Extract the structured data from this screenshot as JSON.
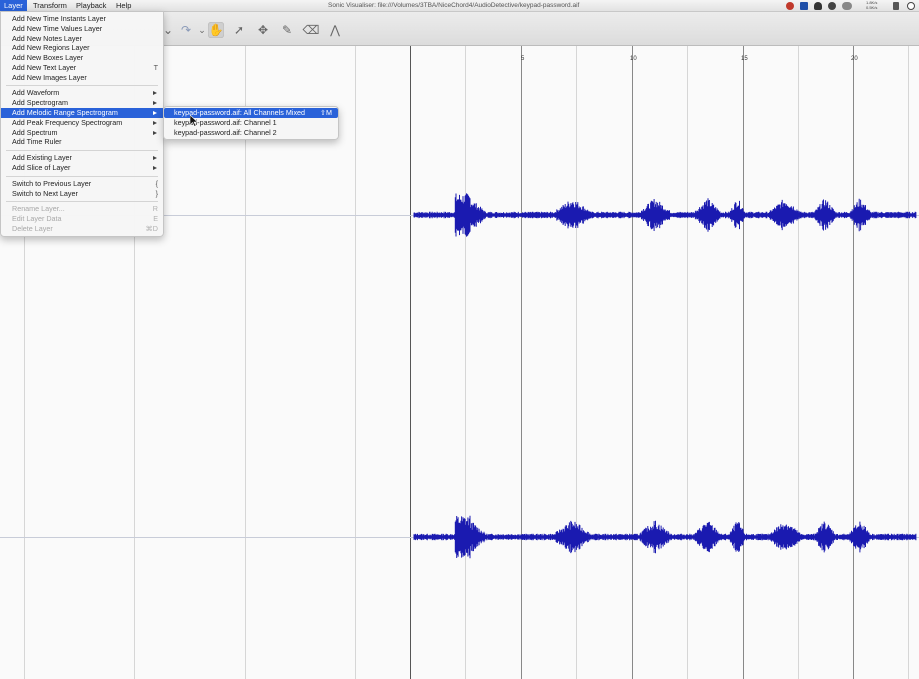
{
  "menubar": {
    "items": [
      {
        "label": "Layer",
        "active": true
      },
      {
        "label": "Transform",
        "active": false
      },
      {
        "label": "Playback",
        "active": false
      },
      {
        "label": "Help",
        "active": false
      }
    ],
    "window_title": "Sonic Visualiser: file:///Volumes/3TBA/NiceChord4/AudioDetective/keypad-password.aif",
    "tray_icons": [
      "record-icon",
      "screen-icon",
      "cloud-icon",
      "drop-icon",
      "toggle-icon",
      "speaker-icon",
      "power-icon"
    ],
    "tray_text": [
      "1.8K/s",
      "0.5K/s"
    ]
  },
  "toolbar": {
    "tools": [
      "undo-arrow-icon",
      "redo-arrow-icon",
      "navigate-hand-icon",
      "select-arrow-icon",
      "move-cross-icon",
      "draw-pencil-icon",
      "erase-icon",
      "measure-icon"
    ]
  },
  "layer_menu": {
    "items": [
      {
        "label": "Add New Time Instants Layer",
        "shortcut": "",
        "submenu": false,
        "disabled": false
      },
      {
        "label": "Add New Time Values Layer",
        "shortcut": "",
        "submenu": false,
        "disabled": false
      },
      {
        "label": "Add New Notes Layer",
        "shortcut": "",
        "submenu": false,
        "disabled": false
      },
      {
        "label": "Add New Regions Layer",
        "shortcut": "",
        "submenu": false,
        "disabled": false
      },
      {
        "label": "Add New Boxes Layer",
        "shortcut": "",
        "submenu": false,
        "disabled": false
      },
      {
        "label": "Add New Text Layer",
        "shortcut": "T",
        "submenu": false,
        "disabled": false
      },
      {
        "label": "Add New Images Layer",
        "shortcut": "",
        "submenu": false,
        "disabled": false
      },
      {
        "label": "Add Waveform",
        "shortcut": "",
        "submenu": true,
        "disabled": false
      },
      {
        "label": "Add Spectrogram",
        "shortcut": "",
        "submenu": true,
        "disabled": false
      },
      {
        "label": "Add Melodic Range Spectrogram",
        "shortcut": "",
        "submenu": true,
        "disabled": false,
        "highlighted": true
      },
      {
        "label": "Add Peak Frequency Spectrogram",
        "shortcut": "",
        "submenu": true,
        "disabled": false
      },
      {
        "label": "Add Spectrum",
        "shortcut": "",
        "submenu": true,
        "disabled": false
      },
      {
        "label": "Add Time Ruler",
        "shortcut": "",
        "submenu": false,
        "disabled": false
      },
      {
        "label": "Add Existing Layer",
        "shortcut": "",
        "submenu": true,
        "disabled": false
      },
      {
        "label": "Add Slice of Layer",
        "shortcut": "",
        "submenu": true,
        "disabled": false
      },
      {
        "label": "Switch to Previous Layer",
        "shortcut": "{",
        "submenu": false,
        "disabled": false
      },
      {
        "label": "Switch to Next Layer",
        "shortcut": "}",
        "submenu": false,
        "disabled": false
      },
      {
        "label": "Rename Layer...",
        "shortcut": "R",
        "submenu": false,
        "disabled": true
      },
      {
        "label": "Edit Layer Data",
        "shortcut": "E",
        "submenu": false,
        "disabled": true
      },
      {
        "label": "Delete Layer",
        "shortcut": "⌘D",
        "submenu": false,
        "disabled": true
      }
    ]
  },
  "submenu": {
    "items": [
      {
        "label": "keypad-password.aif: All Channels Mixed",
        "shortcut": "⇧M",
        "highlighted": true
      },
      {
        "label": "keypad-password.aif: Channel 1",
        "shortcut": "",
        "highlighted": false
      },
      {
        "label": "keypad-password.aif: Channel 2",
        "shortcut": "",
        "highlighted": false
      }
    ]
  },
  "ruler": {
    "labels": [
      "5",
      "10",
      "15",
      "20"
    ]
  },
  "colors": {
    "accent": "#2a62d9",
    "waveform": "#1a1ab0"
  }
}
